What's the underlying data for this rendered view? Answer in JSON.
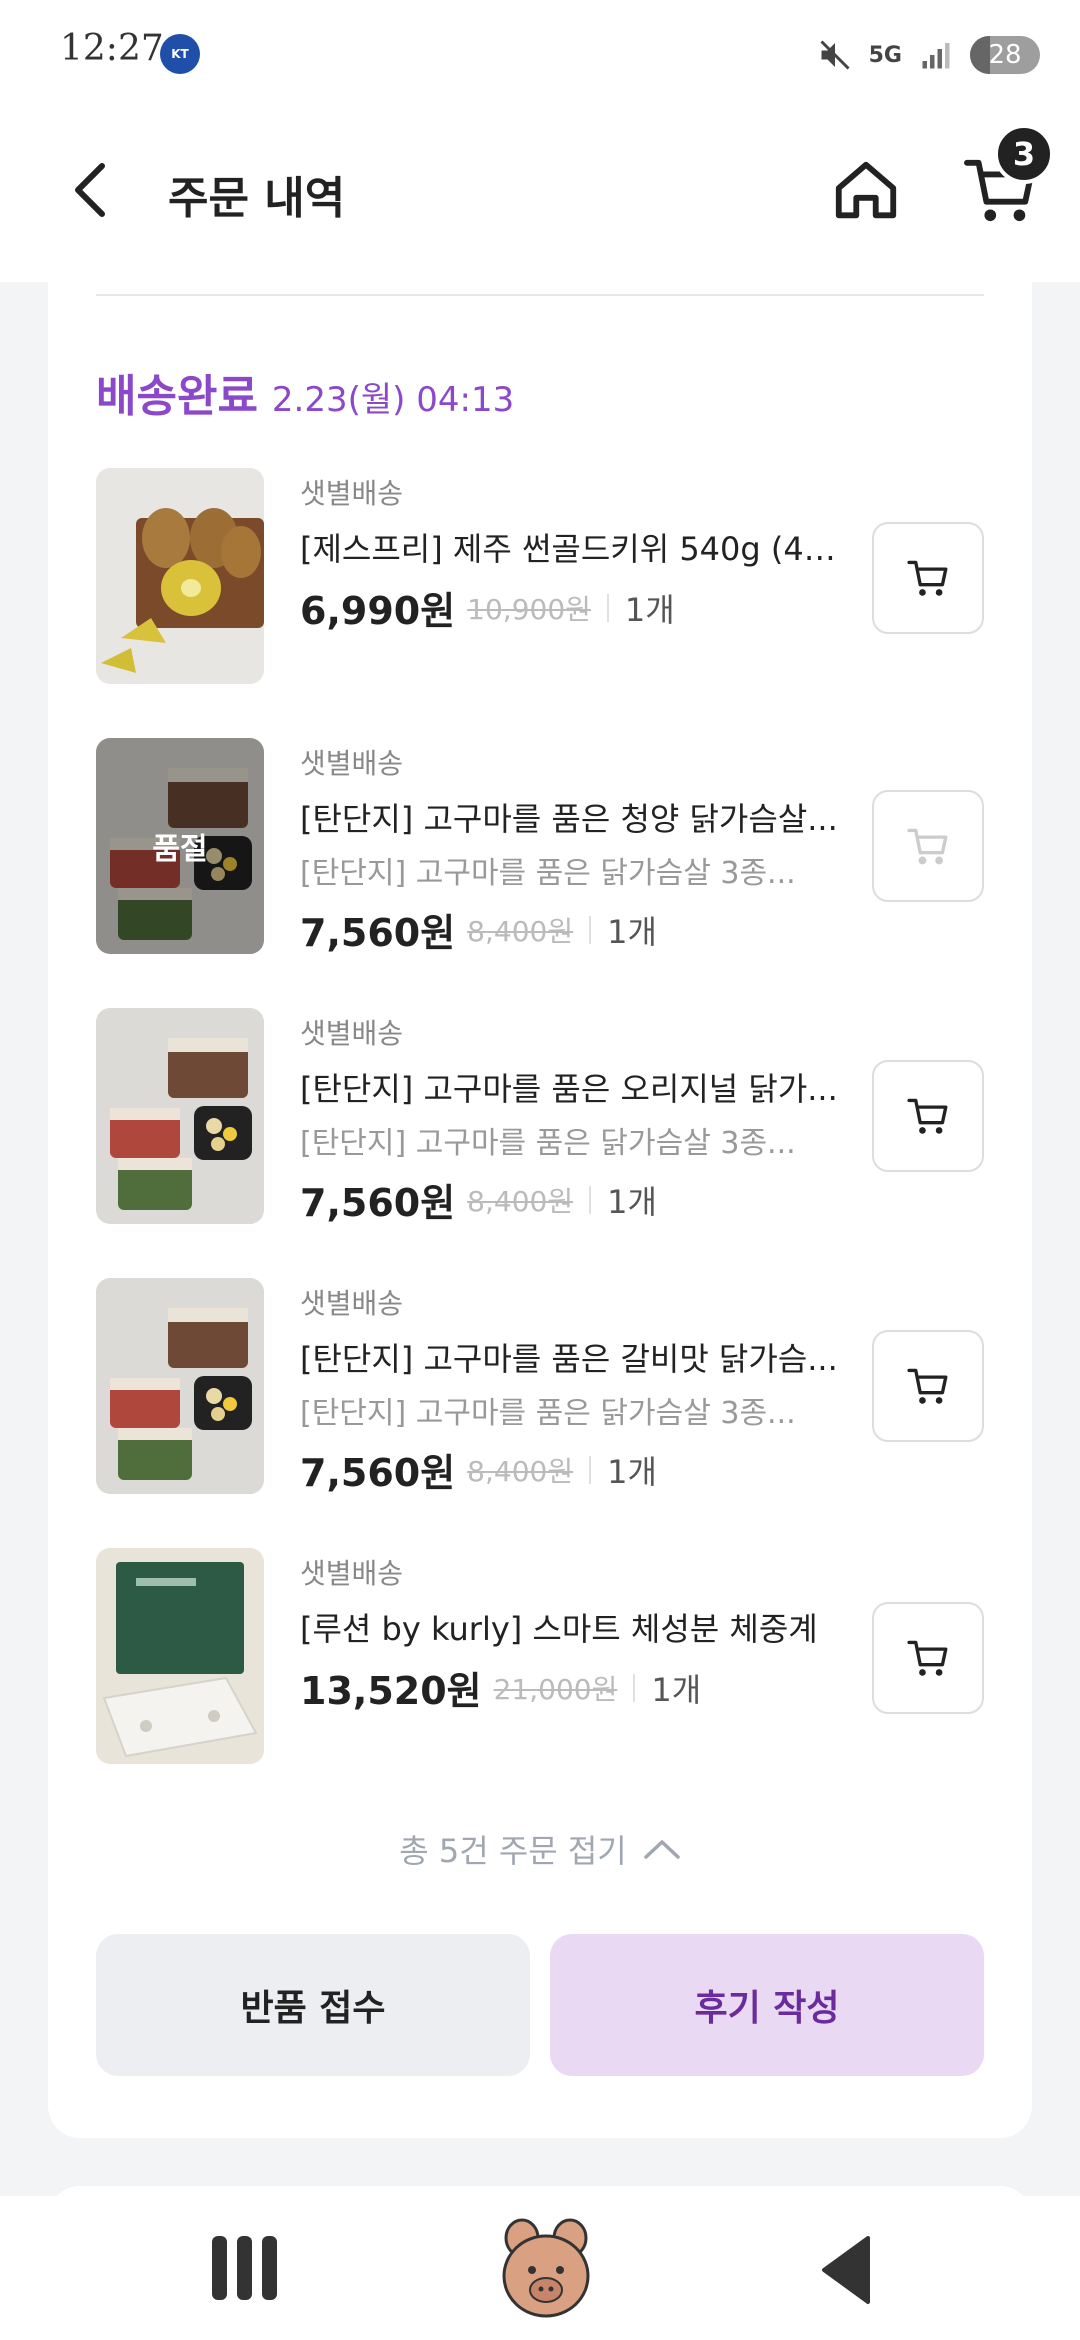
{
  "status_bar": {
    "time": "12:27",
    "app_icon_label": "KT",
    "network_label": "5G",
    "battery": "28",
    "battery_level": 0.28
  },
  "header": {
    "title": "주문 내역",
    "cart_count": "3"
  },
  "order": {
    "status_label": "배송완료",
    "status_date": "2.23(월) 04:13",
    "status_color": "#8b48c9",
    "items": [
      {
        "delivery_type": "샛별배송",
        "name": "[제스프리] 제주 썬골드키위 540g (4~...",
        "option": "",
        "price": "6,990원",
        "original_price": "10,900원",
        "quantity": "1개",
        "soldout": false
      },
      {
        "delivery_type": "샛별배송",
        "name": "[탄단지] 고구마를 품은 청양 닭가슴살...",
        "option": "[탄단지] 고구마를 품은 닭가슴살 3종...",
        "price": "7,560원",
        "original_price": "8,400원",
        "quantity": "1개",
        "soldout": true,
        "soldout_label": "품절"
      },
      {
        "delivery_type": "샛별배송",
        "name": "[탄단지] 고구마를 품은 오리지널 닭가...",
        "option": "[탄단지] 고구마를 품은 닭가슴살 3종...",
        "price": "7,560원",
        "original_price": "8,400원",
        "quantity": "1개",
        "soldout": false
      },
      {
        "delivery_type": "샛별배송",
        "name": "[탄단지] 고구마를 품은 갈비맛 닭가슴...",
        "option": "[탄단지] 고구마를 품은 닭가슴살 3종...",
        "price": "7,560원",
        "original_price": "8,400원",
        "quantity": "1개",
        "soldout": false
      },
      {
        "delivery_type": "샛별배송",
        "name": "[루션 by kurly] 스마트 체성분 체중계",
        "option": "",
        "price": "13,520원",
        "original_price": "21,000원",
        "quantity": "1개",
        "soldout": false
      }
    ],
    "collapse_label": "총 5건 주문 접기",
    "return_button": "반품 접수",
    "review_button": "후기 작성"
  },
  "icons": {
    "back": "chevron-left-icon",
    "home": "home-icon",
    "cart": "cart-icon",
    "add_to_cart": "cart-icon",
    "collapse": "chevron-up-icon"
  }
}
